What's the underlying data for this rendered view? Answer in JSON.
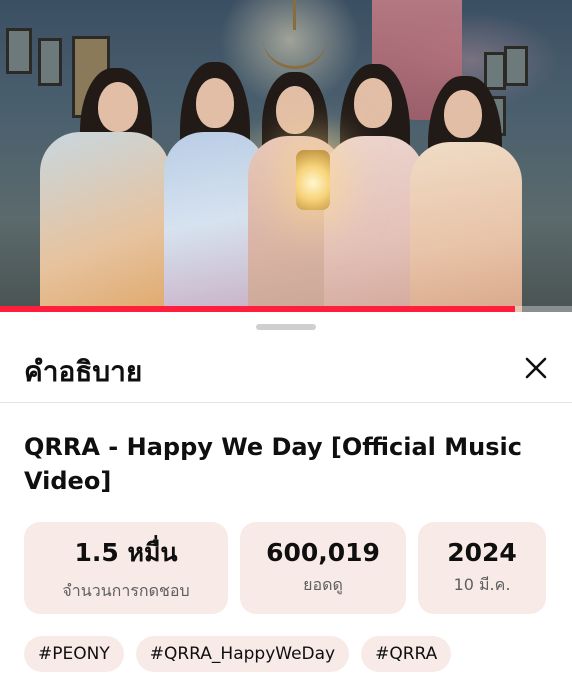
{
  "video": {
    "progress_fraction": 0.9
  },
  "sheet": {
    "title": "คำอธิบาย",
    "video_title": "QRRA - Happy We Day [Official Music Video]",
    "stats": [
      {
        "value": "1.5 หมื่น",
        "label": "จำนวนการกดชอบ"
      },
      {
        "value": "600,019",
        "label": "ยอดดู"
      },
      {
        "value": "2024",
        "label": "10 มี.ค."
      }
    ],
    "hashtags": [
      "#PEONY",
      "#QRRA_HappyWeDay",
      "#QRRA"
    ]
  },
  "icons": {
    "close": "close-icon"
  },
  "colors": {
    "progress": "#ff1f3d",
    "chip_bg": "#f8ebe7"
  }
}
